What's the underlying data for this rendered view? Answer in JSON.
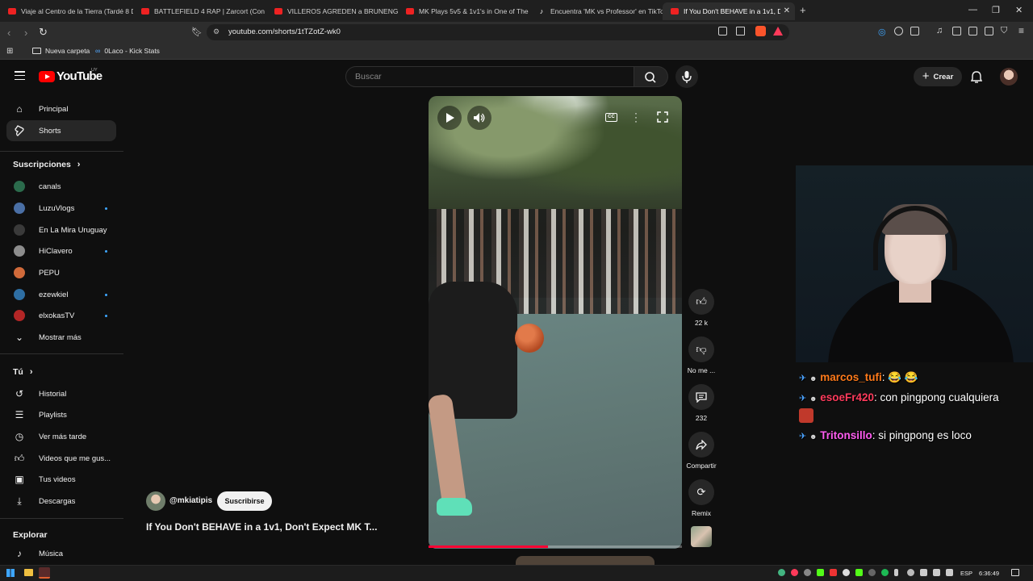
{
  "browser": {
    "tabs": [
      {
        "title": "Viaje al Centro de la Tierra (Tardé 8 D",
        "icon": "youtube-icon",
        "active": false
      },
      {
        "title": "BATTLEFIELD 4 RAP | Zarcort (Con Pi",
        "icon": "youtube-icon",
        "active": false
      },
      {
        "title": "VILLEROS AGREDEN a BRUNENGER y",
        "icon": "youtube-icon",
        "active": false
      },
      {
        "title": "MK Plays 5v5 & 1v1's in One of The M",
        "icon": "youtube-icon",
        "active": false
      },
      {
        "title": "Encuentra 'MK vs Professor' en TikTo",
        "icon": "tiktok-icon",
        "active": false
      },
      {
        "title": "If You Don't BEHAVE in a 1v1, Do",
        "icon": "youtube-icon",
        "active": true
      }
    ],
    "url": "youtube.com/shorts/1tTZotZ-wk0",
    "bookmarks": [
      "Nueva carpeta",
      "0Laco - Kick Stats"
    ]
  },
  "header": {
    "logo_text": "YouTube",
    "region": "UY",
    "search_placeholder": "Buscar",
    "create_label": "Crear"
  },
  "sidebar": {
    "top_items": [
      {
        "label": "Principal",
        "icon": "home-icon"
      },
      {
        "label": "Shorts",
        "icon": "shorts-icon",
        "active": true
      }
    ],
    "subscriptions_heading": "Suscripciones",
    "channels": [
      {
        "label": "canals",
        "color": "#2b6b4c",
        "dot": false
      },
      {
        "label": "LuzuVlogs",
        "color": "#4a6fa5",
        "dot": true
      },
      {
        "label": "En La Mira Uruguay",
        "color": "#3a3a3a",
        "dot": false
      },
      {
        "label": "HiClavero",
        "color": "#8d8d8d",
        "dot": true
      },
      {
        "label": "PEPU",
        "color": "#d06a3a",
        "dot": false
      },
      {
        "label": "ezewkiel",
        "color": "#2e6ea3",
        "dot": true
      },
      {
        "label": "elxokasTV",
        "color": "#b32626",
        "dot": true
      }
    ],
    "show_more": "Mostrar más",
    "you_heading": "Tú",
    "you_items": [
      {
        "label": "Historial",
        "icon": "history-icon"
      },
      {
        "label": "Playlists",
        "icon": "playlists-icon"
      },
      {
        "label": "Ver más tarde",
        "icon": "watch-later-icon"
      },
      {
        "label": "Videos que me gus...",
        "icon": "liked-icon"
      },
      {
        "label": "Tus videos",
        "icon": "your-videos-icon"
      },
      {
        "label": "Descargas",
        "icon": "downloads-icon"
      }
    ],
    "explore_heading": "Explorar",
    "explore_items": [
      {
        "label": "Música",
        "icon": "music-icon"
      }
    ]
  },
  "short": {
    "channel_handle": "@mkiatipis",
    "subscribe_label": "Suscribirse",
    "title": "If You Don't BEHAVE in a 1v1, Don't Expect MK T...",
    "progress": 0.47,
    "actions": [
      {
        "label": "22 k",
        "icon": "like-icon"
      },
      {
        "label": "No me ...",
        "icon": "dislike-icon"
      },
      {
        "label": "232",
        "icon": "comment-icon"
      },
      {
        "label": "Compartir",
        "icon": "share-icon"
      },
      {
        "label": "Remix",
        "icon": "remix-icon"
      }
    ]
  },
  "stream_chat": [
    {
      "user": "marcos_tufi",
      "message": ": 😂 😂"
    },
    {
      "user": "esoeFr420",
      "message": ": con pingpong cualquiera"
    },
    {
      "user": "Tritonsillo",
      "message": ": si pingpong es loco"
    }
  ],
  "taskbar": {
    "language": "ESP",
    "clock": "6:36:49"
  }
}
